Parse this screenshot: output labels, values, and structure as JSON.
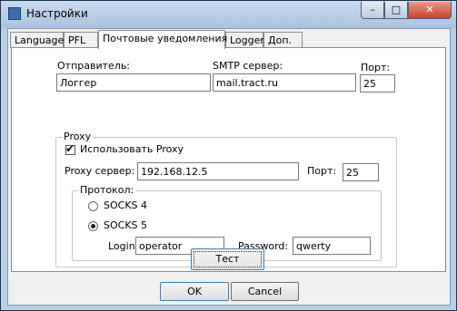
{
  "window": {
    "title": "Настройки",
    "controls": {
      "minimize": "–",
      "maximize": "□",
      "close": "✕"
    }
  },
  "tabs": [
    {
      "label": "Language"
    },
    {
      "label": "PFL"
    },
    {
      "label": "Почтовые уведомления",
      "active": true
    },
    {
      "label": "Logger"
    },
    {
      "label": "Доп."
    }
  ],
  "mail": {
    "sender_label": "Отправитель:",
    "sender_value": "Логгер",
    "smtp_label": "SMTP сервер:",
    "smtp_value": "mail.tract.ru",
    "port_label": "Порт:",
    "port_value": "25"
  },
  "proxy": {
    "group_label": "Proxy",
    "use_proxy_label": "Использовать Proxy",
    "use_proxy_checked": true,
    "server_label": "Proxy сервер:",
    "server_value": "192.168.12.5",
    "port_label": "Порт:",
    "port_value": "25",
    "protocol": {
      "group_label": "Протокол:",
      "options": [
        {
          "label": "SOCKS 4",
          "selected": false
        },
        {
          "label": "SOCKS 5",
          "selected": true
        }
      ],
      "login_label": "Login:",
      "login_value": "operator",
      "password_label": "Password:",
      "password_value": "qwerty"
    }
  },
  "test_button": "Тест",
  "ok_button": "OK",
  "cancel_button": "Cancel"
}
